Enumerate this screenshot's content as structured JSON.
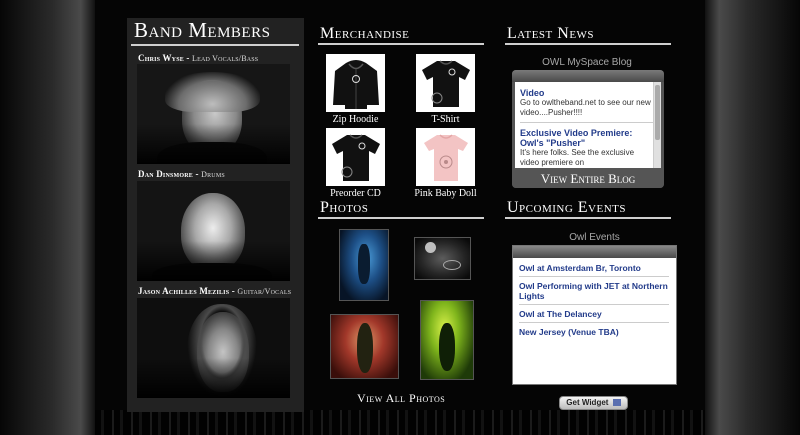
{
  "band": {
    "title": "Band Members",
    "members": [
      {
        "name": "Chris Wyse",
        "role": "Lead Vocals/Bass"
      },
      {
        "name": "Dan Dinsmore",
        "role": "Drums"
      },
      {
        "name": "Jason Achilles Mezilis",
        "role": "Guitar/Vocals"
      }
    ]
  },
  "merch": {
    "title": "Merchandise",
    "items": [
      {
        "label": "Zip Hoodie"
      },
      {
        "label": "T-Shirt"
      },
      {
        "label": "Preorder CD"
      },
      {
        "label": "Pink Baby Doll"
      }
    ]
  },
  "photos": {
    "title": "Photos",
    "view_all": "View All Photos"
  },
  "news": {
    "title": "Latest News",
    "caption": "OWL MySpace Blog",
    "items": [
      {
        "title": "Video",
        "text": "Go to owltheband.net to see our new video....Pusher!!!!"
      },
      {
        "title": "Exclusive Video Premiere: Owl's \"Pusher\"",
        "text": "It's here folks. See the exclusive video premiere on"
      }
    ],
    "view_blog": "View Entire Blog"
  },
  "events": {
    "title": "Upcoming Events",
    "caption": "Owl Events",
    "items": [
      {
        "label": "Owl at Amsterdam Br, Toronto"
      },
      {
        "label": "Owl Performing with JET at Northern Lights"
      },
      {
        "label": "Owl at The Delancey"
      },
      {
        "label": "New Jersey (Venue TBA)"
      }
    ]
  },
  "widget": {
    "label": "Get Widget"
  },
  "colors": {
    "link": "#223b8a",
    "panel": "#222222",
    "background": "#000000"
  },
  "icons": [
    "owl-logo-icon",
    "widget-icon"
  ]
}
